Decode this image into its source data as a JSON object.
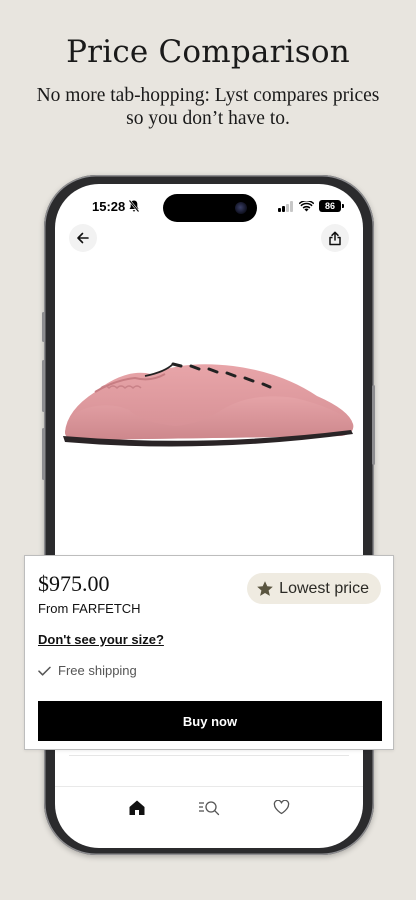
{
  "marketing": {
    "headline": "Price Comparison",
    "subhead": "No more tab-hopping: Lyst compares prices so you don’t have to."
  },
  "status_bar": {
    "time": "15:28",
    "battery": "86",
    "icons": [
      "bell-slash-icon",
      "signal-icon",
      "wifi-icon",
      "battery-icon"
    ]
  },
  "product_view": {
    "top_actions": [
      "back-arrow-icon",
      "share-icon"
    ],
    "image": "pink-suede-lace-up-sneaker"
  },
  "price_card": {
    "price": "$975.00",
    "seller": "From FARFETCH",
    "badge": "Lowest price",
    "badge_icon": "star-icon",
    "size_link": "Don't see your size?",
    "shipping": "Free shipping",
    "shipping_icon": "check-icon",
    "buy_label": "Buy now"
  },
  "tab_bar": {
    "tabs": [
      "home-icon",
      "search-list-icon",
      "heart-icon"
    ],
    "active": "home-icon"
  },
  "colors": {
    "background": "#e8e5df",
    "badge_bg": "#efebe1",
    "button": "#000000",
    "star": "#5a5540"
  }
}
